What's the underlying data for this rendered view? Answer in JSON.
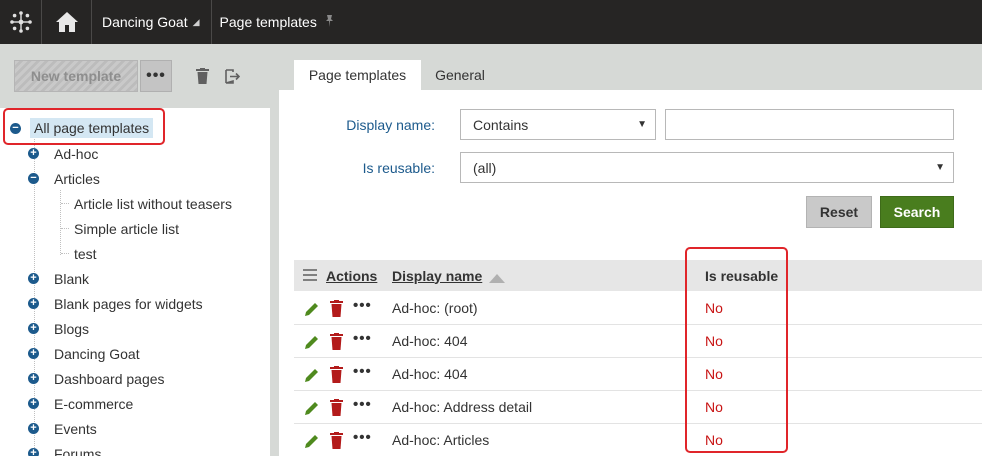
{
  "topbar": {
    "site_name": "Dancing Goat",
    "app_name": "Page templates"
  },
  "left_toolbar": {
    "new_template_label": "New template",
    "more_label": "•••"
  },
  "tree": {
    "root": "All page templates",
    "items": [
      {
        "label": "Ad-hoc"
      },
      {
        "label": "Articles"
      },
      {
        "label": "Article list without teasers"
      },
      {
        "label": "Simple article list"
      },
      {
        "label": "test"
      },
      {
        "label": "Blank"
      },
      {
        "label": "Blank pages for widgets"
      },
      {
        "label": "Blogs"
      },
      {
        "label": "Dancing Goat"
      },
      {
        "label": "Dashboard pages"
      },
      {
        "label": "E-commerce"
      },
      {
        "label": "Events"
      },
      {
        "label": "Forums"
      }
    ]
  },
  "tabs": [
    {
      "label": "Page templates"
    },
    {
      "label": "General"
    }
  ],
  "filter": {
    "display_name_label": "Display name:",
    "display_name_operator": "Contains",
    "display_name_value": "",
    "is_reusable_label": "Is reusable:",
    "is_reusable_value": "(all)",
    "reset_label": "Reset",
    "search_label": "Search"
  },
  "grid": {
    "columns": {
      "actions": "Actions",
      "display_name": "Display name",
      "is_reusable": "Is reusable"
    },
    "sort": "ascending",
    "rows": [
      {
        "display_name": "Ad-hoc: (root)",
        "is_reusable": "No"
      },
      {
        "display_name": "Ad-hoc: 404",
        "is_reusable": "No"
      },
      {
        "display_name": "Ad-hoc: 404",
        "is_reusable": "No"
      },
      {
        "display_name": "Ad-hoc: Address detail",
        "is_reusable": "No"
      },
      {
        "display_name": "Ad-hoc: Articles",
        "is_reusable": "No"
      }
    ]
  },
  "colors": {
    "topbar_bg": "#262524",
    "panel_bg": "#d6d9d6",
    "label_blue": "#1c5a8c",
    "search_green": "#497d1e",
    "no_red": "#c81414",
    "annotation_red": "#e0252a",
    "delete_red": "#b31b1b",
    "edit_green": "#4f8a1e"
  }
}
